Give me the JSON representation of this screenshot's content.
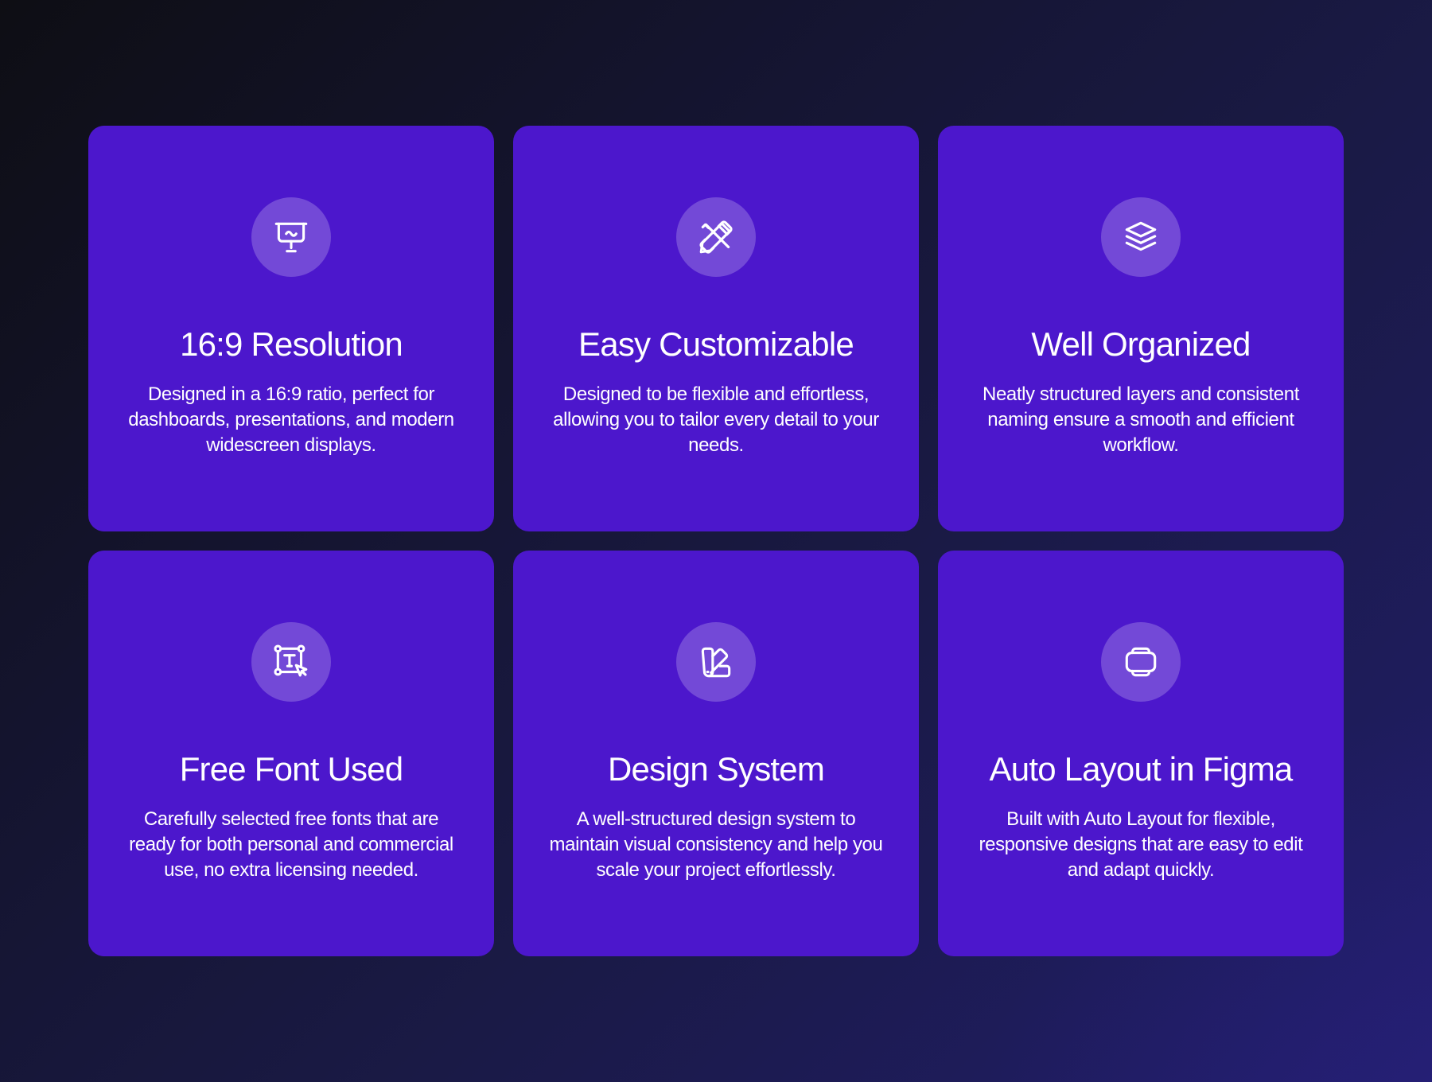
{
  "features": [
    {
      "icon": "presentation-board-icon",
      "title": "16:9 Resolution",
      "description": "Designed in a 16:9 ratio, perfect for dashboards, presentations, and modern widescreen displays."
    },
    {
      "icon": "pencil-ruler-icon",
      "title": "Easy Customizable",
      "description": "Designed to be flexible and effortless, allowing you to tailor every detail to your needs."
    },
    {
      "icon": "layers-icon",
      "title": "Well Organized",
      "description": "Neatly structured layers and consistent naming ensure a smooth and efficient workflow."
    },
    {
      "icon": "text-selection-cursor-icon",
      "title": "Free Font Used",
      "description": "Carefully selected free fonts that are ready for both personal and commercial use, no extra licensing needed."
    },
    {
      "icon": "design-swatch-icon",
      "title": "Design System",
      "description": "A well-structured design system to maintain visual consistency and help you scale your project effortlessly."
    },
    {
      "icon": "auto-layout-frame-icon",
      "title": "Auto Layout in Figma",
      "description": "Built with Auto Layout for flexible, responsive designs that are easy to edit and adapt quickly."
    }
  ],
  "colors": {
    "card": "#4c17cc",
    "text": "#ffffff",
    "icon_circle": "rgba(255,255,255,0.22)"
  }
}
